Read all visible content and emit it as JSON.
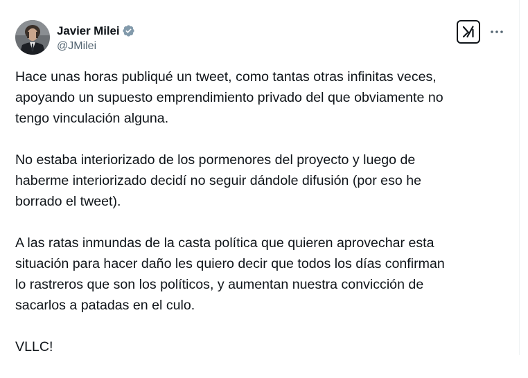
{
  "author": {
    "display_name": "Javier Milei",
    "handle": "@JMilei",
    "verified": true,
    "verified_color": "#829aab"
  },
  "actions": {
    "grok_icon": "grok-icon",
    "more_icon": "more-dots-icon"
  },
  "tweet": {
    "paragraphs": [
      "Hace unas horas publiqué un tweet, como tantas otras infinitas veces,\napoyando un supuesto emprendimiento privado del que obviamente no\ntengo vinculación alguna.",
      "No estaba interiorizado de los pormenores del proyecto y luego de\nhaberme interiorizado decidí no seguir dándole difusión (por eso he\nborrado el tweet).",
      "A las ratas inmundas de la casta política que quieren aprovechar esta\nsituación para hacer daño les quiero decir que todos los días confirman\nlo rastreros que son los políticos, y aumentan nuestra convicción de\nsacarlos a patadas en el culo.",
      "VLLC!"
    ]
  },
  "colors": {
    "text_primary": "#0f1419",
    "text_secondary": "#536471"
  }
}
